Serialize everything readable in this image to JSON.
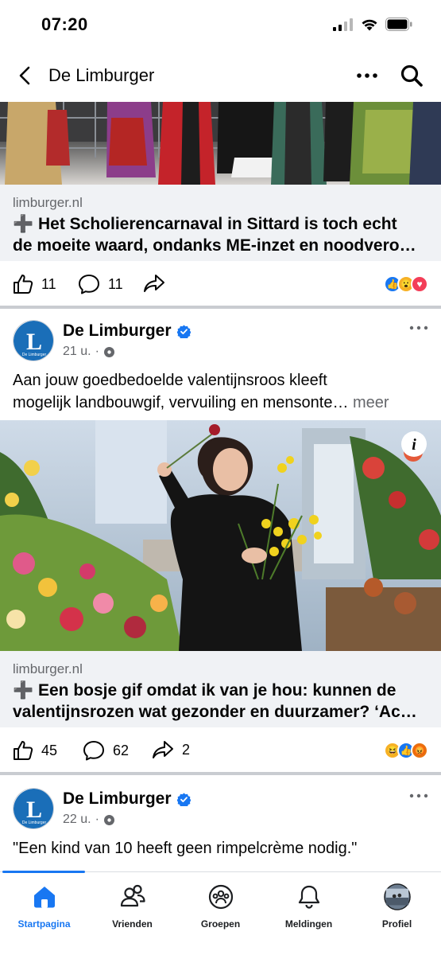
{
  "status_bar": {
    "time": "07:20"
  },
  "header": {
    "title": "De Limburger"
  },
  "post1": {
    "link_domain": "limburger.nl",
    "link_title_line1": "➕ Het Scholierencarnaval in Sittard is toch echt",
    "link_title_line2": "de moeite waard, ondanks ME-inzet en noodvero…",
    "likes": "11",
    "comments": "11"
  },
  "post2": {
    "page_name": "De Limburger",
    "time": "21 u.",
    "text_line1": "Aan jouw goedbedoelde valentijnsroos kleeft",
    "text_line2": "mogelijk landbouwgif, vervuiling en mensonte…",
    "more_label": "meer",
    "link_domain": "limburger.nl",
    "link_title_line1": "➕ Een bosje gif omdat ik van je hou: kunnen de",
    "link_title_line2": "valentijnsrozen wat gezonder en duurzamer? ‘Ac…",
    "likes": "45",
    "comments": "62",
    "shares": "2",
    "avatar_text": "De Limburger"
  },
  "post3": {
    "page_name": "De Limburger",
    "time": "22 u.",
    "text": "\"Een kind van 10 heeft geen rimpelcrème nodig.\"",
    "avatar_text": "De Limburger"
  },
  "bottom_nav": {
    "items": [
      {
        "label": "Startpagina",
        "icon": "home-icon"
      },
      {
        "label": "Vrienden",
        "icon": "friends-icon"
      },
      {
        "label": "Groepen",
        "icon": "groups-icon"
      },
      {
        "label": "Meldingen",
        "icon": "bell-icon"
      },
      {
        "label": "Profiel",
        "icon": "profile-avatar"
      }
    ]
  },
  "colors": {
    "accent": "#1877f2",
    "secondary_text": "#65676b",
    "link_box_bg": "#f0f2f5",
    "divider": "#c9ccd1"
  }
}
